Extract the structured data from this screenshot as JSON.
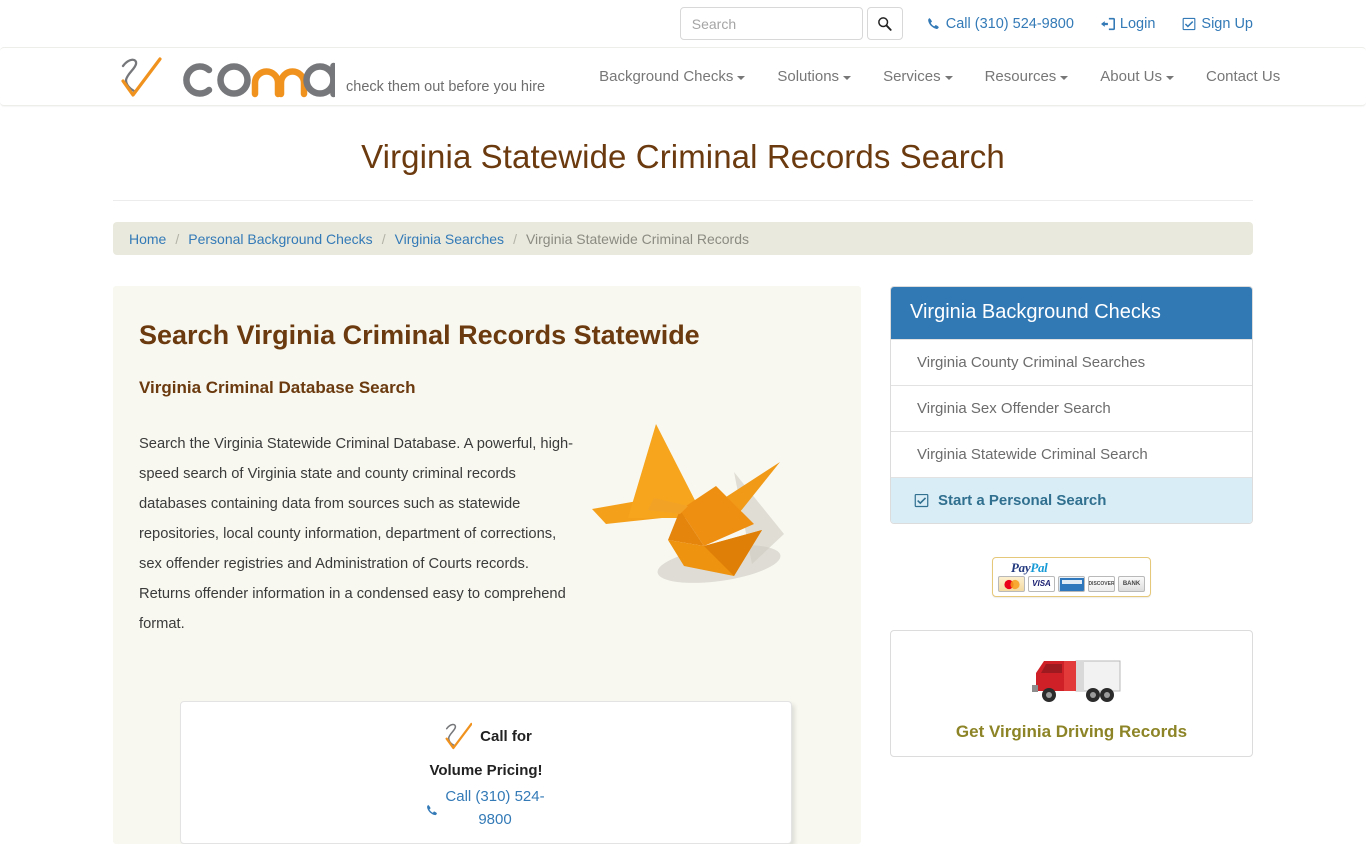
{
  "topbar": {
    "search": {
      "placeholder": "Search",
      "value": ""
    },
    "search_button_icon": "search-icon",
    "links": [
      {
        "label": "Call (310) 524-9800",
        "icon": "phone-icon"
      },
      {
        "label": "Login",
        "icon": "sign-in-icon"
      },
      {
        "label": "Sign Up",
        "icon": "check-square-icon"
      }
    ]
  },
  "brand": {
    "logo_text": "corra",
    "tagline": "check them out before you hire"
  },
  "nav": [
    {
      "label": "Background Checks",
      "caret": true
    },
    {
      "label": "Solutions",
      "caret": true
    },
    {
      "label": "Services",
      "caret": true
    },
    {
      "label": "Resources",
      "caret": true
    },
    {
      "label": "About Us",
      "caret": true
    },
    {
      "label": "Contact Us",
      "caret": false
    }
  ],
  "page": {
    "title": "Virginia Statewide Criminal Records Search"
  },
  "breadcrumb": [
    {
      "label": "Home",
      "active": false
    },
    {
      "label": "Personal Background Checks",
      "active": false
    },
    {
      "label": "Virginia Searches",
      "active": false
    },
    {
      "label": "Virginia Statewide Criminal Records",
      "active": true
    }
  ],
  "main": {
    "heading": "Search Virginia Criminal Records Statewide",
    "subheading": "Virginia Criminal Database Search",
    "paragraph": "Search the Virginia Statewide Criminal Database. A powerful, high-speed search of Virginia state and county criminal records databases containing data from sources such as statewide repositories, local county information, department of corrections, sex offender registries and Administration of Courts records. Returns offender information in a condensed easy to comprehend format.",
    "crane_image_alt": "orange-origami-crane",
    "volume_box": {
      "line1": "Call for",
      "line2": "Volume Pricing!",
      "phone": "Call (310) 524-9800",
      "phone_icon": "phone-icon",
      "check_icon": "corra-check-icon"
    }
  },
  "sidebar": {
    "panel_title": "Virginia Background Checks",
    "items": [
      {
        "label": "Virginia County Criminal Searches",
        "highlight": false
      },
      {
        "label": "Virginia Sex Offender Search",
        "highlight": false
      },
      {
        "label": "Virginia Statewide Criminal Search",
        "highlight": false
      },
      {
        "label": "Start a Personal Search",
        "highlight": true,
        "icon": "check-square-icon"
      }
    ],
    "paypal": {
      "brand_pay": "Pay",
      "brand_pal": "Pal",
      "cards": [
        "MasterCard",
        "VISA",
        "AMEX",
        "DISCOVER",
        "BANK"
      ]
    },
    "promo": {
      "image_alt": "red-semi-truck",
      "title": "Get Virginia Driving Records"
    }
  },
  "colors": {
    "brand_blue": "#337ab7",
    "panel_head_blue": "#3179b5",
    "title_brown": "#6b3a0e",
    "logo_orange": "#f0921e",
    "logo_gray": "#76777a",
    "highlight_bg": "#d9edf7",
    "highlight_text": "#31708f",
    "promo_gold": "#8c8426",
    "breadcrumb_bg": "#e9e9dd",
    "content_bg": "#f8f8f1"
  }
}
